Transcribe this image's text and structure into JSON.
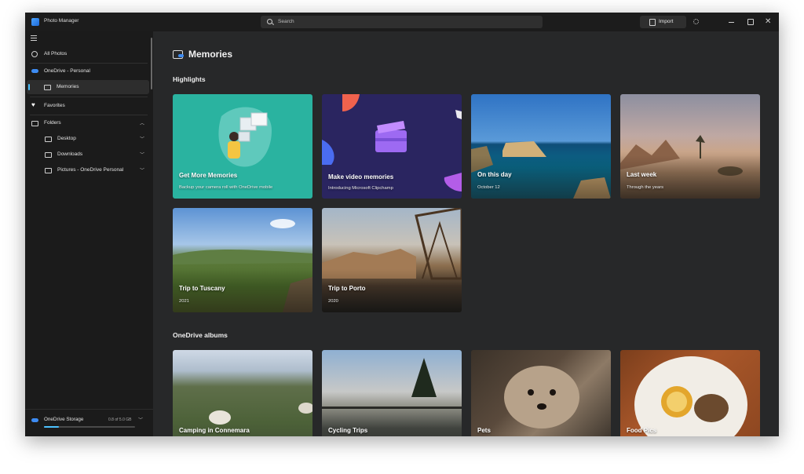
{
  "app": {
    "title": "Photo Manager"
  },
  "titlebar": {
    "search_placeholder": "Search",
    "import_label": "Import"
  },
  "sidebar": {
    "all_photos": "All Photos",
    "onedrive": "OneDrive - Personal",
    "memories": "Memories",
    "favorites": "Favorites",
    "folders": "Folders",
    "folder_items": [
      "Desktop",
      "Downloads",
      "Pictures - OneDrive Personal"
    ],
    "storage": {
      "label": "OneDrive Storage",
      "amount": "0.8 of 5.0 GB",
      "used_fraction": 0.16
    }
  },
  "main": {
    "title": "Memories",
    "highlights_title": "Highlights",
    "albums_title": "OneDrive albums",
    "highlights": [
      {
        "title": "Get More Memories",
        "subtitle": "Backup your camera roll with OneDrive mobile"
      },
      {
        "title": "Make video memories",
        "subtitle": "Introducing Microsoft Clipchamp"
      },
      {
        "title": "On this day",
        "subtitle": "October 12"
      },
      {
        "title": "Last week",
        "subtitle": "Through the years"
      },
      {
        "title": "Trip to Tuscany",
        "subtitle": "2021"
      },
      {
        "title": "Trip to Porto",
        "subtitle": "2020"
      }
    ],
    "albums": [
      {
        "title": "Camping in Connemara"
      },
      {
        "title": "Cycling Trips"
      },
      {
        "title": "Pets"
      },
      {
        "title": "Food Pics"
      }
    ]
  }
}
